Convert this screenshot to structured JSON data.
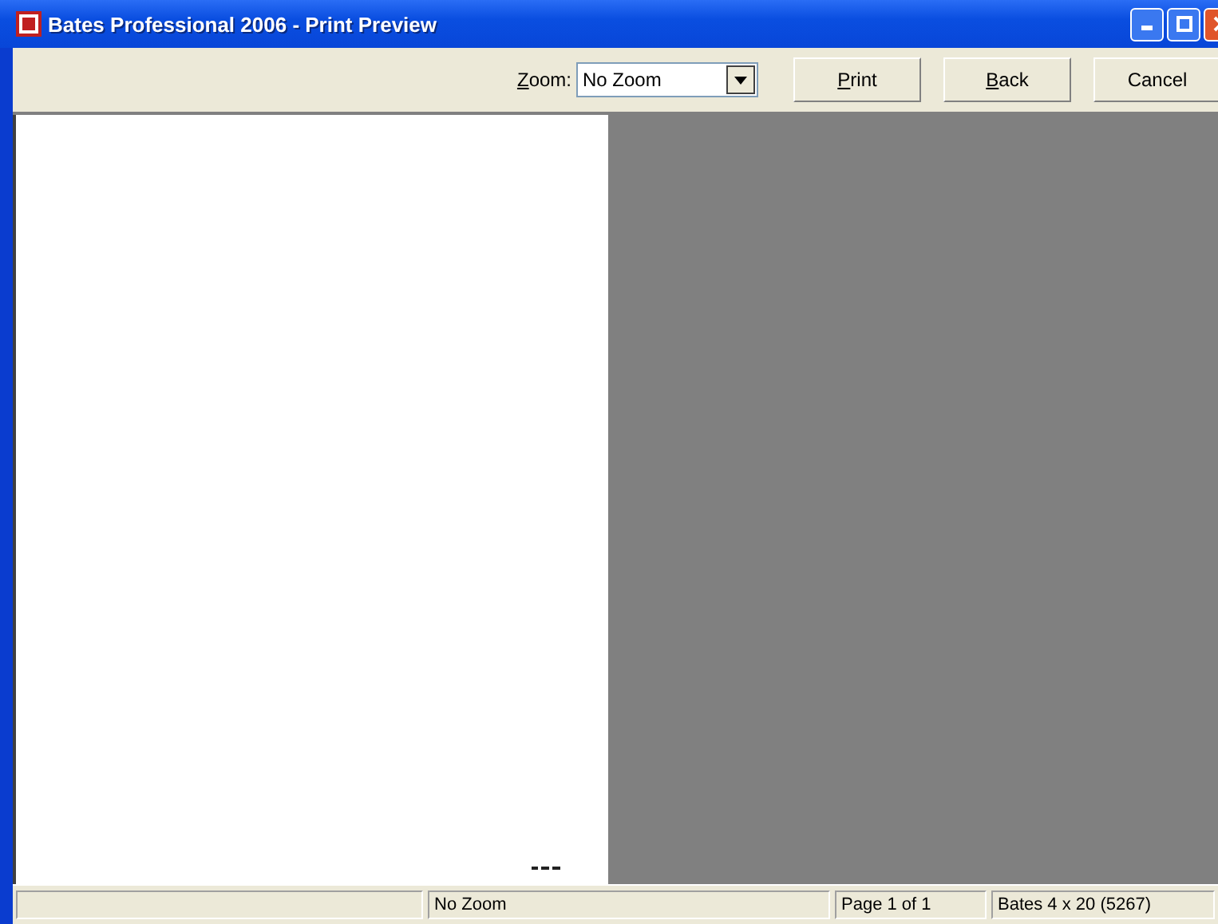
{
  "window": {
    "title": "Bates Professional 2006 - Print Preview"
  },
  "toolbar": {
    "zoom_label": "Zoom:",
    "zoom_value": "No Zoom",
    "buttons": [
      {
        "label": "Print",
        "mnemonic": true
      },
      {
        "label": "Back",
        "mnemonic": true
      },
      {
        "label": "Cancel",
        "mnemonic": false
      }
    ]
  },
  "status_bar": [
    "No Zoom",
    "Page 1 of 1",
    "Bates 4 x 20 (5267)"
  ]
}
